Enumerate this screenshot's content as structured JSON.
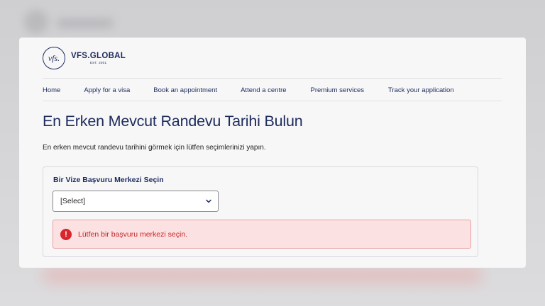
{
  "brand": {
    "logo_mark": "vfs.",
    "name": "VFS.GLOBAL",
    "established": "EST. 2001"
  },
  "nav": {
    "items": [
      {
        "label": "Home"
      },
      {
        "label": "Apply for a visa"
      },
      {
        "label": "Book an appointment"
      },
      {
        "label": "Attend a centre"
      },
      {
        "label": "Premium services"
      },
      {
        "label": "Track your application"
      }
    ]
  },
  "main": {
    "title": "En Erken Mevcut Randevu Tarihi Bulun",
    "subtitle": "En erken mevcut randevu tarihini görmek için lütfen seçimlerinizi yapın.",
    "form": {
      "centre_label": "Bir Vize Başvuru Merkezi Seçin",
      "centre_select_value": "[Select]"
    },
    "error": {
      "icon": "exclamation-circle-icon",
      "message": "Lütfen bir başvuru merkezi seçin."
    }
  },
  "colors": {
    "brand_navy": "#1d2b5c",
    "error_red": "#d9252b",
    "error_bg": "#fbe1e1"
  }
}
